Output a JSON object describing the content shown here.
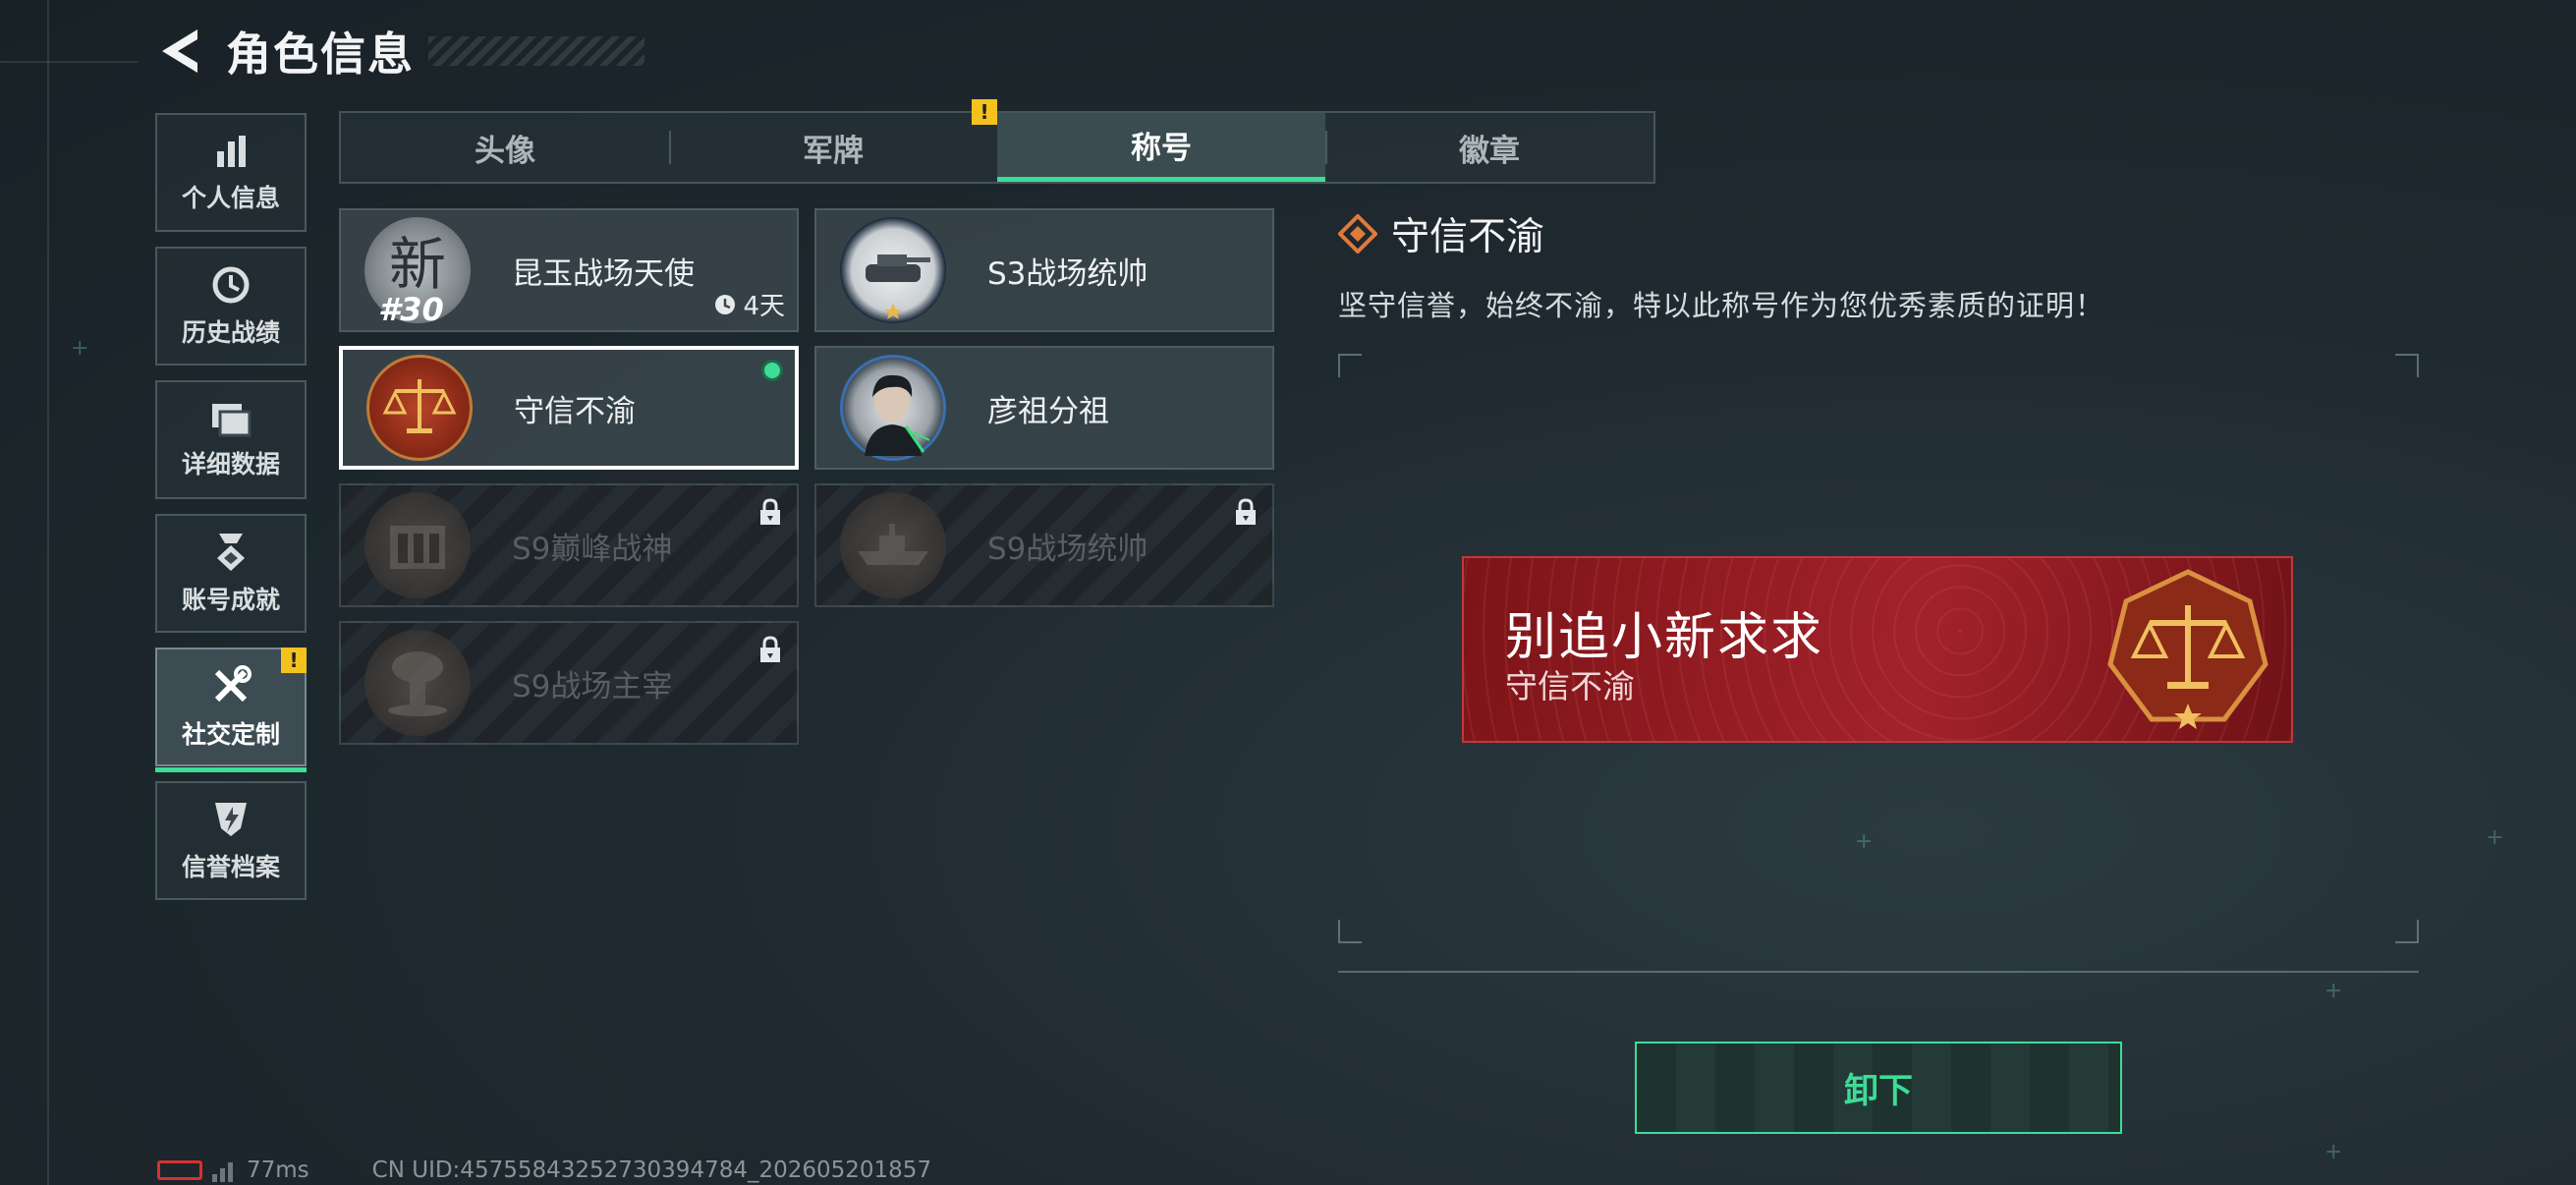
{
  "header": {
    "title": "角色信息",
    "back_icon": "back-arrow-icon"
  },
  "sidebar": {
    "items": [
      {
        "label": "个人信息",
        "icon": "bar-chart-icon",
        "active": false,
        "warning": false
      },
      {
        "label": "历史战绩",
        "icon": "history-clock-icon",
        "active": false,
        "warning": false
      },
      {
        "label": "详细数据",
        "icon": "folder-icon",
        "active": false,
        "warning": false
      },
      {
        "label": "账号成就",
        "icon": "achievement-medal-icon",
        "active": false,
        "warning": false
      },
      {
        "label": "社交定制",
        "icon": "tools-icon",
        "active": true,
        "warning": true
      },
      {
        "label": "信誉档案",
        "icon": "reputation-shield-icon",
        "active": false,
        "warning": false
      }
    ],
    "warning_mark": "!"
  },
  "tabs": [
    {
      "label": "头像",
      "active": false,
      "warning": false
    },
    {
      "label": "军牌",
      "active": false,
      "warning": true
    },
    {
      "label": "称号",
      "active": true,
      "warning": false
    },
    {
      "label": "徽章",
      "active": false,
      "warning": false
    }
  ],
  "cards": [
    {
      "name": "昆玉战场天使",
      "emblem": "new-season-emblem",
      "rank": "#30",
      "timer": "4天",
      "locked": false,
      "selected": false,
      "equipped": false
    },
    {
      "name": "S3战场统帅",
      "emblem": "tank-emblem",
      "locked": false,
      "selected": false,
      "equipped": false
    },
    {
      "name": "守信不渝",
      "emblem": "scales-emblem",
      "locked": false,
      "selected": true,
      "equipped": true
    },
    {
      "name": "彦祖分祖",
      "emblem": "portrait-emblem",
      "locked": false,
      "selected": false,
      "equipped": false
    },
    {
      "name": "S9巅峰战神",
      "emblem": "fortress-emblem",
      "locked": true,
      "selected": false,
      "equipped": false
    },
    {
      "name": "S9战场统帅",
      "emblem": "warship-emblem",
      "locked": true,
      "selected": false,
      "equipped": false
    },
    {
      "name": "S9战场主宰",
      "emblem": "explosion-emblem",
      "locked": true,
      "selected": false,
      "equipped": false
    }
  ],
  "detail": {
    "title": "守信不渝",
    "description": "坚守信誉，始终不渝，特以此称号作为您优秀素质的证明！"
  },
  "preview": {
    "player_name": "别追小新求求",
    "title_name": "守信不渝"
  },
  "actions": {
    "unequip_label": "卸下"
  },
  "footer": {
    "ping": "77ms",
    "uid": "CN UID:45755843252730394784_202605201857"
  },
  "colors": {
    "accent_green": "#3ddc97",
    "warning_yellow": "#f4c21d",
    "preview_red": "#a3222a",
    "battery_red": "#d8302f"
  }
}
